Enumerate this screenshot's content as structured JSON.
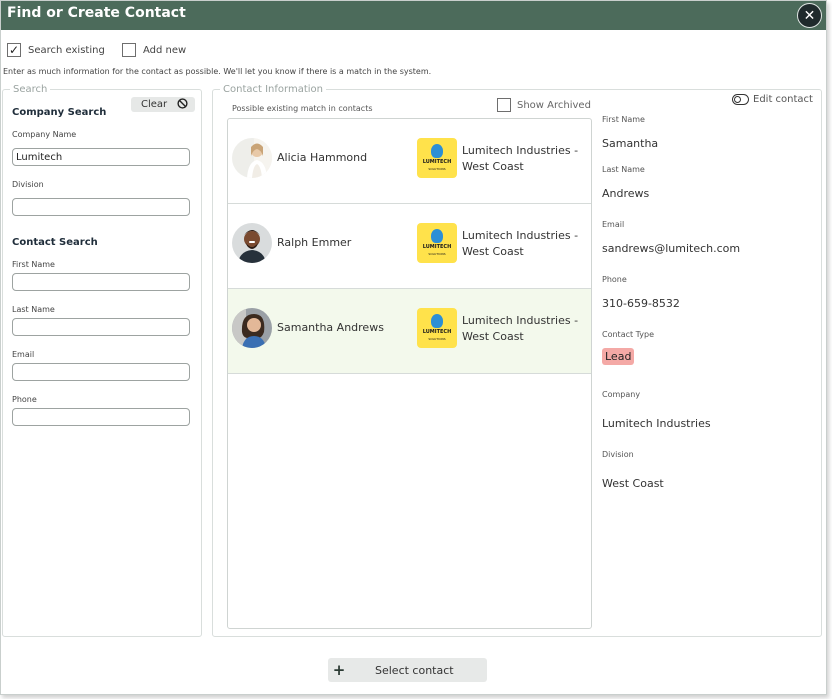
{
  "dialog": {
    "title": "Find or Create Contact",
    "close_icon": "close-icon"
  },
  "options": {
    "search_existing": {
      "label": "Search existing",
      "checked": true
    },
    "add_new": {
      "label": "Add new",
      "checked": false
    }
  },
  "hint": "Enter as much information for the contact as possible. We'll let you know if there is a match in the system.",
  "search": {
    "legend": "Search",
    "clear_label": "Clear",
    "company_heading": "Company Search",
    "company_name_label": "Company Name",
    "company_name_value": "Lumitech",
    "division_label": "Division",
    "division_value": "",
    "contact_heading": "Contact Search",
    "first_name_label": "First Name",
    "last_name_label": "Last Name",
    "email_label": "Email",
    "phone_label": "Phone"
  },
  "contact_info": {
    "legend": "Contact Information",
    "possible_label": "Possible existing match in contacts",
    "show_archived_label": "Show Archived",
    "show_archived_checked": false,
    "edit_contact_label": "Edit contact"
  },
  "matches": [
    {
      "name": "Alicia Hammond",
      "company": "Lumitech Industries - West Coast",
      "selected": false
    },
    {
      "name": "Ralph Emmer",
      "company": "Lumitech Industries - West Coast",
      "selected": false
    },
    {
      "name": "Samantha  Andrews",
      "company": "Lumitech Industries - West Coast",
      "selected": true
    }
  ],
  "logo": {
    "text": "LUMITECH",
    "sub": "SOLUTIONS"
  },
  "details": {
    "first_name_label": "First Name",
    "first_name": "Samantha",
    "last_name_label": "Last Name",
    "last_name": "Andrews",
    "email_label": "Email",
    "email": "sandrews@lumitech.com",
    "phone_label": "Phone",
    "phone": "310-659-8532",
    "contact_type_label": "Contact Type",
    "contact_type": "Lead",
    "company_label": "Company",
    "company": "Lumitech Industries",
    "division_label": "Division",
    "division": "West Coast"
  },
  "footer": {
    "select_label": "Select contact"
  },
  "colors": {
    "titlebar": "#4c6b5b",
    "selected_row": "#f3f9ec",
    "lead_badge": "#f4a9a6",
    "logo_bg": "#ffe24b"
  }
}
